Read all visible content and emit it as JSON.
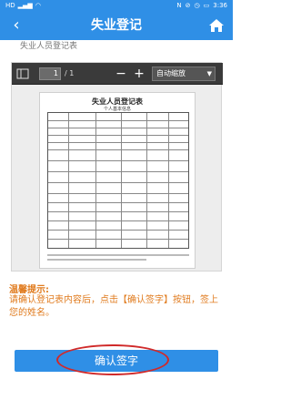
{
  "status_bar": {
    "left_icons": [
      "hd-icon",
      "signal-icon",
      "wifi-icon"
    ],
    "right_icons": [
      "nfc-icon",
      "mute-icon",
      "alarm-icon",
      "battery-icon"
    ],
    "time": "3:36"
  },
  "app_bar": {
    "title": "失业登记",
    "back_icon": "chevron-left-icon",
    "home_icon": "home-icon",
    "color": "#2f8fe6"
  },
  "subtitle": "失业人员登记表",
  "pdf_viewer": {
    "page_current": "1",
    "page_total": "/ 1",
    "zoom_out": "−",
    "zoom_in": "+",
    "zoom_mode": "自动缩放"
  },
  "document": {
    "title": "失业人员登记表",
    "subtitle": "个人基本信息"
  },
  "tip": {
    "title": "温馨提示:",
    "text": "请确认登记表内容后，点击【确认签字】按钮，签上您的姓名。",
    "color": "#e07b1e"
  },
  "confirm_button": {
    "label": "确认签字"
  }
}
